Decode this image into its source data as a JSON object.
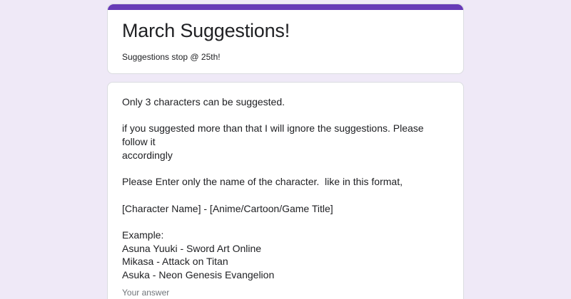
{
  "colors": {
    "background": "#efe9f7",
    "accent": "#673ab7",
    "card": "#ffffff"
  },
  "header": {
    "title": "March Suggestions!",
    "description": "Suggestions stop @ 25th!"
  },
  "question": {
    "lines": [
      "Only 3 characters can be suggested.",
      "",
      "if you suggested more than that I will ignore the suggestions. Please follow it",
      "accordingly",
      "",
      "Please Enter only the name of the character.  like in this format,",
      "",
      "[Character Name] - [Anime/Cartoon/Game Title]",
      "",
      "Example:",
      "Asuna Yuuki - Sword Art Online",
      "Mikasa - Attack on Titan",
      "Asuka - Neon Genesis Evangelion"
    ]
  },
  "answer": {
    "placeholder": "Your answer",
    "value": ""
  }
}
